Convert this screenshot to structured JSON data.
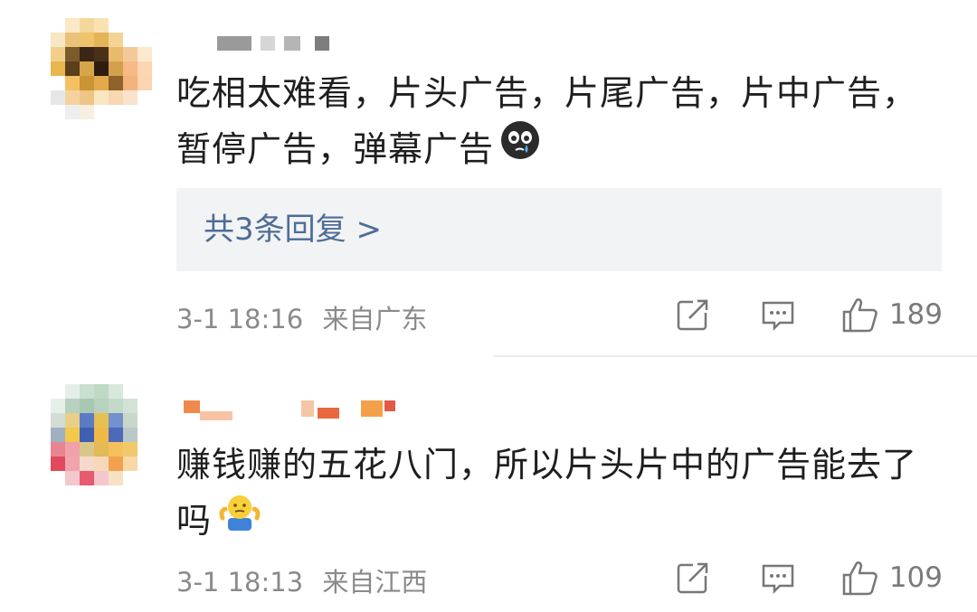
{
  "comments": [
    {
      "content": "吃相太难看，片头广告，片尾广告，片中广告，暂停广告，弹幕广告",
      "emoji": "crying-face-emoji",
      "replies_label": "共3条回复 >",
      "time": "3-1 18:16",
      "location": "来自广东",
      "likes": "189"
    },
    {
      "content": "赚钱赚的五花八门，所以片头片中的广告能去了吗",
      "emoji": "shrug-emoji",
      "time": "3-1 18:13",
      "location": "来自江西",
      "likes": "109"
    }
  ],
  "icons": {
    "share": "share-icon",
    "comment": "comment-icon",
    "like": "thumbs-up-icon"
  },
  "colors": {
    "text": "#1e1e1e",
    "meta": "#8a8a8a",
    "link": "#4e6d96",
    "reply_bg": "#f2f3f5"
  }
}
